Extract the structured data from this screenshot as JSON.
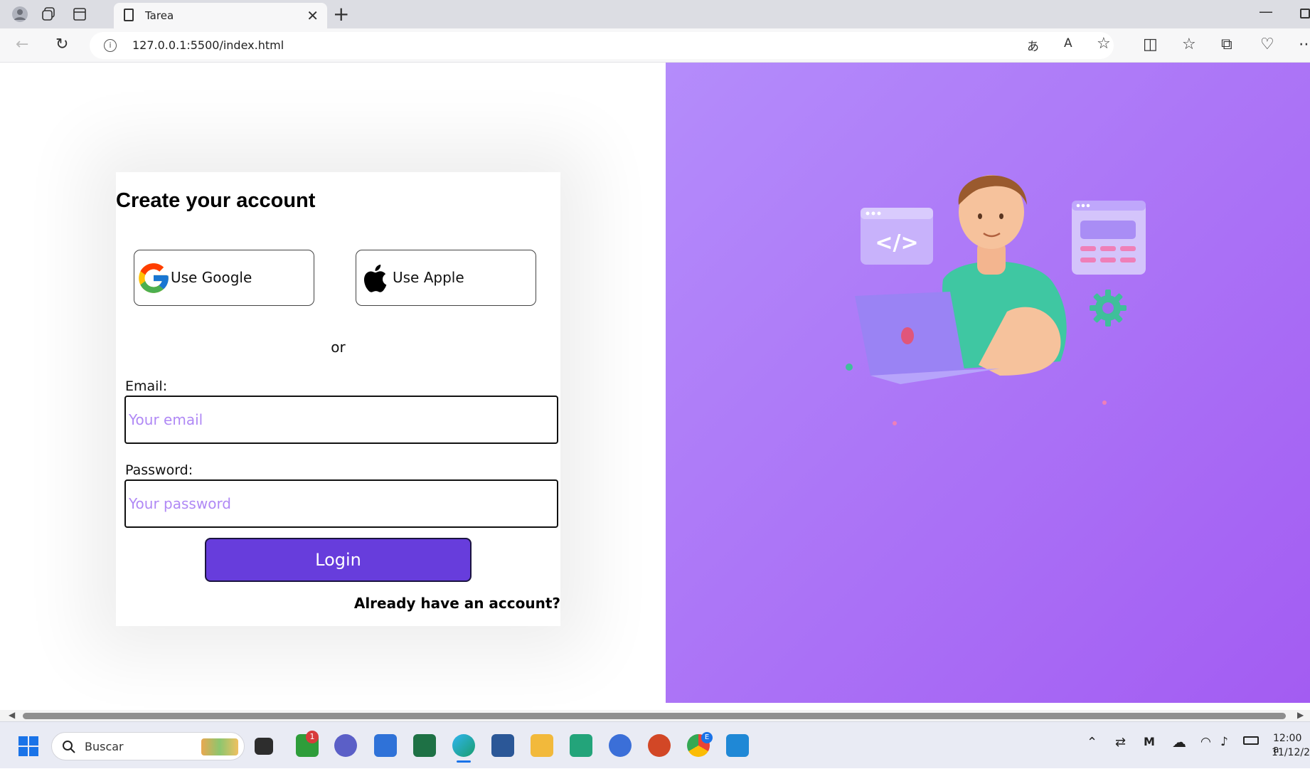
{
  "browser": {
    "tab_title": "Tarea",
    "url": "127.0.0.1:5500/index.html"
  },
  "page": {
    "title": "Create your account",
    "google_label": "Use Google",
    "apple_label": "Use Apple",
    "or_text": "or",
    "email_label": "Email:",
    "email_placeholder": "Your email",
    "password_label": "Password:",
    "password_placeholder": "Your password",
    "login_label": "Login",
    "already_text": "Already have an account?",
    "hero_colors": [
      "#b48cfb",
      "#a35cf2"
    ]
  },
  "taskbar": {
    "search_placeholder": "Buscar",
    "notification_count": "1",
    "chrome_badge": "E",
    "clock_time": "12:00 a",
    "clock_date": "11/12/2"
  }
}
